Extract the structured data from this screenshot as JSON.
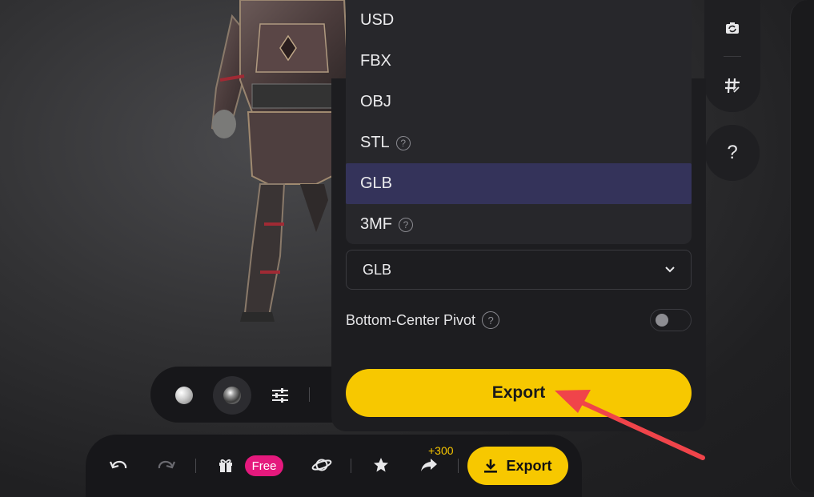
{
  "format_options": [
    {
      "label": "USD",
      "help": false,
      "selected": false
    },
    {
      "label": "FBX",
      "help": false,
      "selected": false
    },
    {
      "label": "OBJ",
      "help": false,
      "selected": false
    },
    {
      "label": "STL",
      "help": true,
      "selected": false
    },
    {
      "label": "GLB",
      "help": false,
      "selected": true
    },
    {
      "label": "3MF",
      "help": true,
      "selected": false
    }
  ],
  "format_select": {
    "value": "GLB"
  },
  "pivot": {
    "label": "Bottom-Center Pivot",
    "enabled": false
  },
  "export_panel": {
    "button_label": "Export"
  },
  "side_panel": {
    "help_label": "?"
  },
  "bottom_toolbar": {
    "free_badge": "Free",
    "reward_label": "+300",
    "export_label": "Export"
  },
  "colors": {
    "accent_yellow": "#f7c800",
    "free_pink": "#e5197d",
    "selected_row": "#34335a",
    "annotation_arrow": "#f0444a"
  }
}
